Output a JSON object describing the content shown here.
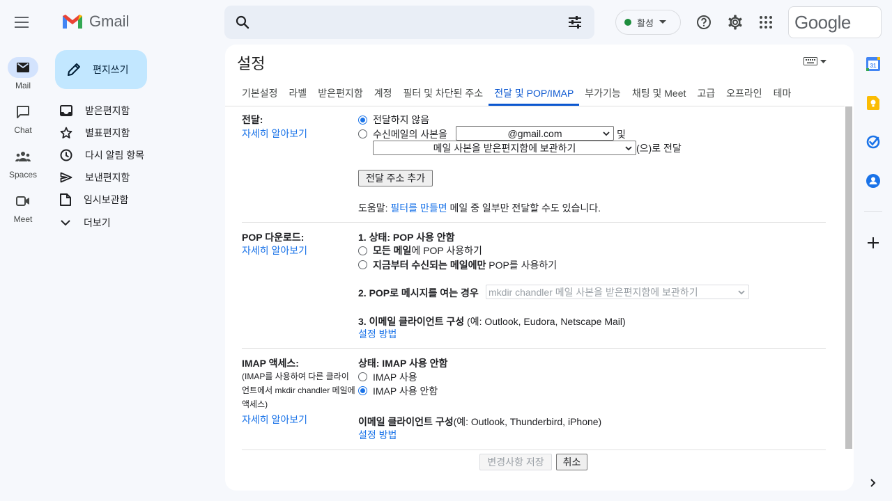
{
  "header": {
    "app_name": "Gmail",
    "status_label": "활성",
    "account_wordmark": "Google"
  },
  "rail": [
    {
      "label": "Mail",
      "icon": "mail-icon"
    },
    {
      "label": "Chat",
      "icon": "chat-icon"
    },
    {
      "label": "Spaces",
      "icon": "spaces-icon"
    },
    {
      "label": "Meet",
      "icon": "meet-icon"
    }
  ],
  "compose_label": "편지쓰기",
  "folders": [
    {
      "label": "받은편지함",
      "icon": "inbox-icon"
    },
    {
      "label": "별표편지함",
      "icon": "star-icon"
    },
    {
      "label": "다시 알림 항목",
      "icon": "clock-icon"
    },
    {
      "label": "보낸편지함",
      "icon": "send-icon"
    },
    {
      "label": "임시보관함",
      "icon": "draft-icon"
    },
    {
      "label": "더보기",
      "icon": "chevron-down-icon"
    }
  ],
  "settings": {
    "title": "설정",
    "tabs": [
      "기본설정",
      "라벨",
      "받은편지함",
      "계정",
      "필터 및 차단된 주소",
      "전달 및 POP/IMAP",
      "부가기능",
      "채팅 및 Meet",
      "고급",
      "오프라인",
      "테마"
    ],
    "active_tab": "전달 및 POP/IMAP",
    "learn_more": "자세히 알아보기",
    "forwarding": {
      "label": "전달:",
      "opt_off": "전달하지 않음",
      "opt_on": "수신메일의 사본을",
      "email_select": "@gmail.com",
      "and": "및",
      "action_select": "메일 사본을 받은편지함에 보관하기",
      "suffix": "(으)로 전달",
      "add_button": "전달 주소 추가",
      "tip_prefix": "도움말: ",
      "tip_link": "필터를 만들면",
      "tip_suffix": " 메일 중 일부만 전달할 수도 있습니다."
    },
    "pop": {
      "label": "POP 다운로드:",
      "status": "1. 상태: POP 사용 안함",
      "opt_all_bold": "모든 메일",
      "opt_all_rest": "에 POP 사용하기",
      "opt_new_bold": "지금부터 수신되는 메일에만",
      "opt_new_rest": " POP를 사용하기",
      "when_label": "2. POP로 메시지를 여는 경우",
      "when_select": "mkdir chandler 메일 사본을 받은편지함에 보관하기",
      "client_bold": "3. 이메일 클라이언트 구성",
      "client_rest": " (예: Outlook, Eudora, Netscape Mail)",
      "setup_link": "설정 방법"
    },
    "imap": {
      "label": "IMAP 액세스:",
      "desc": "(IMAP를 사용하여 다른 클라이언트에서 mkdir chandler 메일에 액세스)",
      "status": "상태: IMAP 사용 안함",
      "opt_on": "IMAP 사용",
      "opt_off": "IMAP 사용 안함",
      "client_bold": "이메일 클라이언트 구성",
      "client_rest": "(예: Outlook, Thunderbird, iPhone)",
      "setup_link": "설정 방법"
    },
    "save_button": "변경사항 저장",
    "cancel_button": "취소"
  },
  "colors": {
    "accent": "#0b57d0",
    "link": "#1a73e8",
    "compose_bg": "#c2e7ff",
    "status_green": "#1e8e3e"
  }
}
